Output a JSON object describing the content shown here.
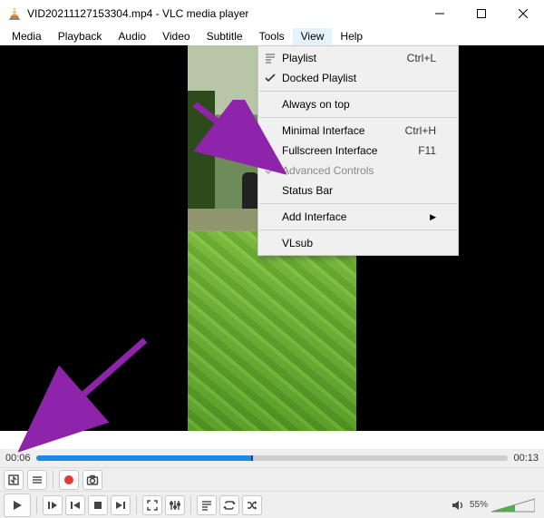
{
  "title": "VID20211127153304.mp4 - VLC media player",
  "menubar": [
    "Media",
    "Playback",
    "Audio",
    "Video",
    "Subtitle",
    "Tools",
    "View",
    "Help"
  ],
  "menubar_open_index": 6,
  "view_menu": {
    "playlist": {
      "label": "Playlist",
      "shortcut": "Ctrl+L"
    },
    "docked": {
      "label": "Docked Playlist"
    },
    "always_on_top": {
      "label": "Always on top"
    },
    "minimal": {
      "label": "Minimal Interface",
      "shortcut": "Ctrl+H"
    },
    "fullscreen": {
      "label": "Fullscreen Interface",
      "shortcut": "F11"
    },
    "advanced": {
      "label": "Advanced Controls"
    },
    "statusbar": {
      "label": "Status Bar"
    },
    "add_interface": {
      "label": "Add Interface"
    },
    "vlsub": {
      "label": "VLsub"
    }
  },
  "time": {
    "current": "00:06",
    "total": "00:13"
  },
  "volume": {
    "percent": "55%"
  }
}
